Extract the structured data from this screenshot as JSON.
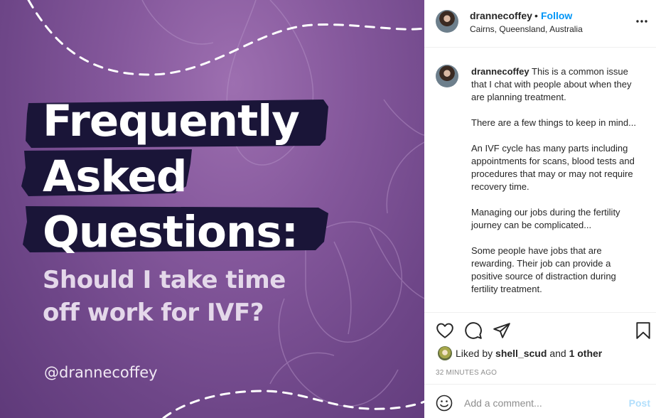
{
  "image": {
    "title_lines": [
      "Frequently",
      "Asked",
      "Questions:"
    ],
    "subtitle_lines": [
      "Should I take time",
      "off work for IVF?"
    ],
    "handle": "@drannecoffey",
    "colors": {
      "background": "#85589c",
      "brush": "#1a1538",
      "title": "#ffffff",
      "subtitle": "#e4d8ea"
    }
  },
  "header": {
    "username": "drannecoffey",
    "separator": "•",
    "follow_label": "Follow",
    "location": "Cairns, Queensland, Australia",
    "more_icon": "more-horizontal-icon"
  },
  "caption": {
    "username": "drannecoffey",
    "paragraphs": [
      "This is a common issue that I chat with people about when they are planning treatment.",
      "There are a few things to keep in mind...",
      "An IVF cycle has many parts including appointments for scans, blood tests and procedures that may or may not require recovery time.",
      "Managing our jobs during the fertility journey can be complicated...",
      "Some people have jobs that are rewarding. Their job can provide a positive source of distraction during fertility treatment."
    ]
  },
  "actions": {
    "icons": [
      "heart-icon",
      "comment-icon",
      "share-icon",
      "bookmark-icon"
    ]
  },
  "likes": {
    "prefix": "Liked by",
    "user": "shell_scud",
    "connector": "and",
    "others": "1 other"
  },
  "timestamp": "32 minutes ago",
  "add_comment": {
    "placeholder": "Add a comment...",
    "post_label": "Post",
    "colors": {
      "post_disabled": "#b2dffc",
      "link": "#0095f6"
    }
  }
}
